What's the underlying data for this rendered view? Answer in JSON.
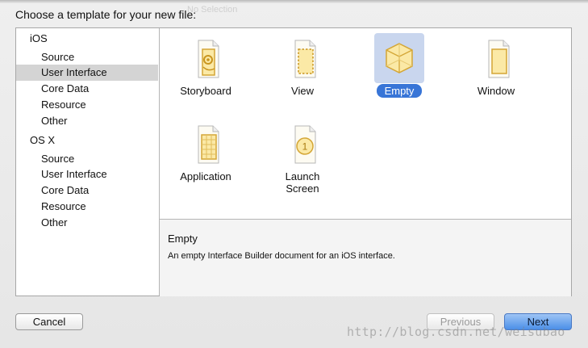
{
  "dialog": {
    "title": "Choose a template for your new file:"
  },
  "background_hint": "No Selection",
  "sidebar": {
    "groups": [
      {
        "label": "iOS",
        "items": [
          "Source",
          "User Interface",
          "Core Data",
          "Resource",
          "Other"
        ]
      },
      {
        "label": "OS X",
        "items": [
          "Source",
          "User Interface",
          "Core Data",
          "Resource",
          "Other"
        ]
      }
    ],
    "selected": "iOS / User Interface"
  },
  "templates": [
    {
      "label": "Storyboard",
      "icon": "storyboard-icon"
    },
    {
      "label": "View",
      "icon": "view-icon"
    },
    {
      "label": "Empty",
      "icon": "empty-cube-icon",
      "selected": true
    },
    {
      "label": "Window",
      "icon": "window-icon"
    },
    {
      "label": "Application",
      "icon": "application-icon"
    },
    {
      "label": "Launch Screen",
      "icon": "launch-screen-icon",
      "badge": "1"
    }
  ],
  "description": {
    "title": "Empty",
    "text": "An empty Interface Builder document for an iOS interface."
  },
  "buttons": {
    "cancel": "Cancel",
    "previous": "Previous",
    "next": "Next"
  },
  "watermark": "http://blog.csdn.net/weisubao",
  "colors": {
    "selection": "#3875d7",
    "icon_fill": "#fbe9a6",
    "icon_stroke": "#d4a636"
  }
}
